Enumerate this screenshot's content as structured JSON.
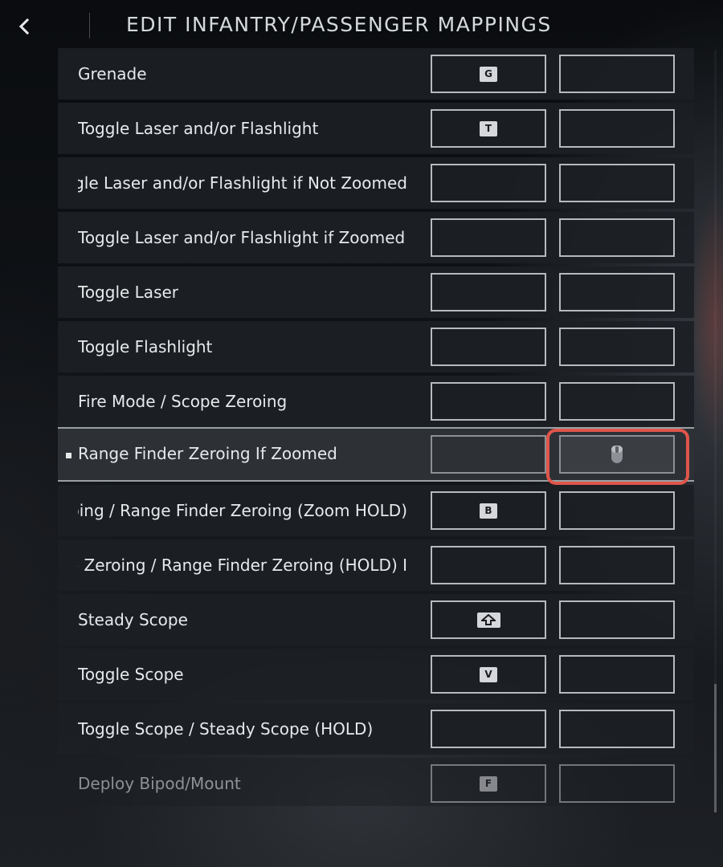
{
  "header": {
    "title": "EDIT INFANTRY/PASSENGER MAPPINGS",
    "back_icon": "chevron-left-icon"
  },
  "rows": [
    {
      "label": "Grenade",
      "primary_key": "G",
      "secondary_key": ""
    },
    {
      "label": "Toggle Laser and/or Flashlight",
      "primary_key": "T",
      "secondary_key": ""
    },
    {
      "label": "Toggle Laser and/or Flashlight if Not Zoomed",
      "primary_key": "",
      "secondary_key": ""
    },
    {
      "label": "Toggle Laser and/or Flashlight if Zoomed",
      "primary_key": "",
      "secondary_key": ""
    },
    {
      "label": "Toggle Laser",
      "primary_key": "",
      "secondary_key": ""
    },
    {
      "label": "Toggle Flashlight",
      "primary_key": "",
      "secondary_key": ""
    },
    {
      "label": "Fire Mode / Scope Zeroing",
      "primary_key": "",
      "secondary_key": ""
    },
    {
      "label": "Range Finder Zeroing If Zoomed",
      "primary_key": "",
      "secondary_key": "mouse-middle-button-icon",
      "selected": true
    },
    {
      "label": "Scope Zeroing / Range Finder Zeroing (Zoom HOLD)",
      "primary_key": "B",
      "secondary_key": ""
    },
    {
      "label": "Scope Zeroing / Range Finder Zeroing (HOLD) I",
      "primary_key": "",
      "secondary_key": ""
    },
    {
      "label": "Steady Scope",
      "primary_key": "shift-key-icon",
      "secondary_key": ""
    },
    {
      "label": "Toggle Scope",
      "primary_key": "V",
      "secondary_key": ""
    },
    {
      "label": "Toggle Scope / Steady Scope (HOLD)",
      "primary_key": "",
      "secondary_key": ""
    },
    {
      "label": "Deploy Bipod/Mount",
      "primary_key": "F",
      "secondary_key": ""
    }
  ],
  "colors": {
    "focus_ring": "#e0554a",
    "row_bg": "#1c1f24",
    "selected_row_bg": "#2d3136",
    "text": "#e7e9eb"
  }
}
